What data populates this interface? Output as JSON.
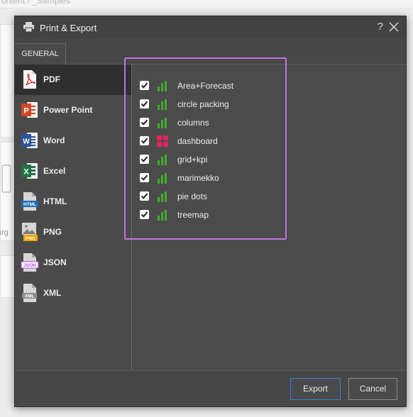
{
  "background": {
    "breadcrumb": "ontent  /  _Samples",
    "partial_label": "arg"
  },
  "dialog": {
    "title": "Print & Export",
    "help": "?",
    "tabs": [
      {
        "label": "GENERAL"
      }
    ],
    "formats": [
      {
        "label": "PDF",
        "icon": "pdf-file-icon",
        "active": true
      },
      {
        "label": "Power Point",
        "icon": "powerpoint-file-icon",
        "active": false
      },
      {
        "label": "Word",
        "icon": "word-file-icon",
        "active": false
      },
      {
        "label": "Excel",
        "icon": "excel-file-icon",
        "active": false
      },
      {
        "label": "HTML",
        "icon": "html-file-icon",
        "active": false
      },
      {
        "label": "PNG",
        "icon": "png-file-icon",
        "active": false
      },
      {
        "label": "JSON",
        "icon": "json-file-icon",
        "active": false
      },
      {
        "label": "XML",
        "icon": "xml-file-icon",
        "active": false
      }
    ],
    "format_icon_text": {
      "pdf": "",
      "html": "HTML",
      "png": "PNG",
      "json": "JSON",
      "xml": "XML"
    },
    "sheets": [
      {
        "label": "Area+Forecast",
        "checked": true,
        "icon": "bar-chart-icon"
      },
      {
        "label": "circle packing",
        "checked": true,
        "icon": "bar-chart-icon"
      },
      {
        "label": "columns",
        "checked": true,
        "icon": "bar-chart-icon"
      },
      {
        "label": "dashboard",
        "checked": true,
        "icon": "dashboard-icon"
      },
      {
        "label": "grid+kpi",
        "checked": true,
        "icon": "bar-chart-icon"
      },
      {
        "label": "marimekko",
        "checked": true,
        "icon": "bar-chart-icon"
      },
      {
        "label": "pie dots",
        "checked": true,
        "icon": "bar-chart-icon"
      },
      {
        "label": "treemap",
        "checked": true,
        "icon": "bar-chart-icon"
      }
    ],
    "buttons": {
      "export": "Export",
      "cancel": "Cancel"
    }
  },
  "colors": {
    "dialog_bg": "#4a4a4a",
    "sidebar_active": "#2f2f2f",
    "highlight": "#c46fe8",
    "chart_icon_green": "#3fae2a",
    "dashboard_icon_red": "#e0245e",
    "export_border": "#3c7fd8",
    "pdf_red": "#d9262c",
    "ppt_orange": "#d24726",
    "word_blue": "#2b579a",
    "excel_green": "#217346"
  }
}
